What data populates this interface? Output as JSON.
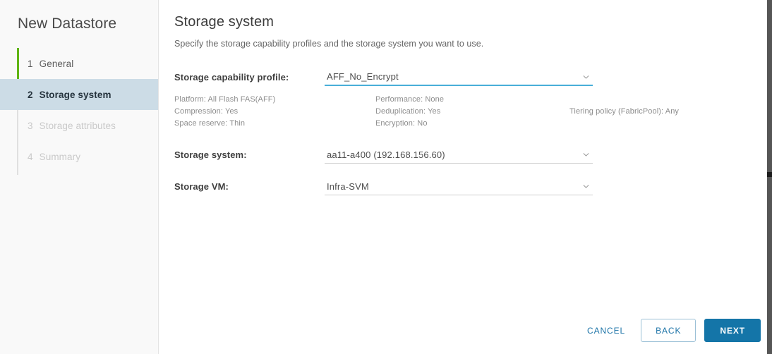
{
  "sidebar": {
    "title": "New Datastore",
    "steps": [
      {
        "num": "1",
        "label": "General",
        "state": "complete"
      },
      {
        "num": "2",
        "label": "Storage system",
        "state": "active"
      },
      {
        "num": "3",
        "label": "Storage attributes",
        "state": "disabled"
      },
      {
        "num": "4",
        "label": "Summary",
        "state": "disabled"
      }
    ]
  },
  "main": {
    "title": "Storage system",
    "subtitle": "Specify the storage capability profiles and the storage system you want to use.",
    "fields": {
      "capability_profile": {
        "label": "Storage capability profile:",
        "value": "AFF_No_Encrypt"
      },
      "storage_system": {
        "label": "Storage system:",
        "value": "aa11-a400 (192.168.156.60)"
      },
      "storage_vm": {
        "label": "Storage VM:",
        "value": "Infra-SVM"
      }
    },
    "profile_details": {
      "platform": "Platform: All Flash FAS(AFF)",
      "compression": "Compression: Yes",
      "space_reserve": "Space reserve: Thin",
      "performance": "Performance: None",
      "deduplication": "Deduplication: Yes",
      "encryption": "Encryption: No",
      "tiering_policy": "Tiering policy (FabricPool): Any"
    }
  },
  "footer": {
    "cancel": "CANCEL",
    "back": "BACK",
    "next": "NEXT"
  },
  "colors": {
    "accent_green": "#60b515",
    "accent_blue": "#1475a8",
    "focus_underline": "#49afd9",
    "active_step_bg": "#ccdce6"
  }
}
